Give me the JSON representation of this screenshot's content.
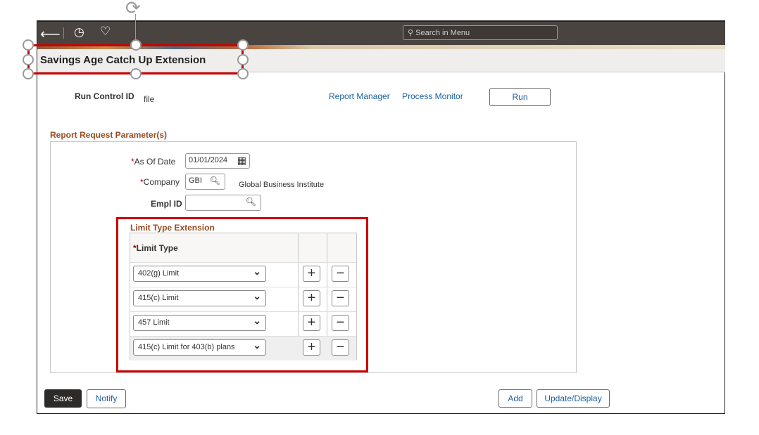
{
  "header": {
    "search_placeholder": "Search in Menu",
    "title": "Savings Age Catch Up Extension"
  },
  "run_control": {
    "label": "Run Control ID",
    "value": "file",
    "report_manager": "Report Manager",
    "process_monitor": "Process Monitor",
    "run": "Run"
  },
  "params": {
    "section": "Report Request Parameter(s)",
    "as_of_date_label": "As Of Date",
    "as_of_date": "01/01/2024",
    "company_label": "Company",
    "company": "GBI",
    "company_desc": "Global Business Institute",
    "emplid_label": "Empl ID",
    "emplid": ""
  },
  "limit": {
    "section": "Limit Type Extension",
    "column": "Limit Type",
    "rows": [
      "402(g) Limit",
      "415(c) Limit",
      "457 Limit",
      "415(c) Limit for 403(b) plans"
    ]
  },
  "footer": {
    "save": "Save",
    "notify": "Notify",
    "add": "Add",
    "update": "Update/Display"
  },
  "colors": {
    "accent": "#9a4a20",
    "highlight": "#c00000",
    "header": "#4a4440"
  }
}
